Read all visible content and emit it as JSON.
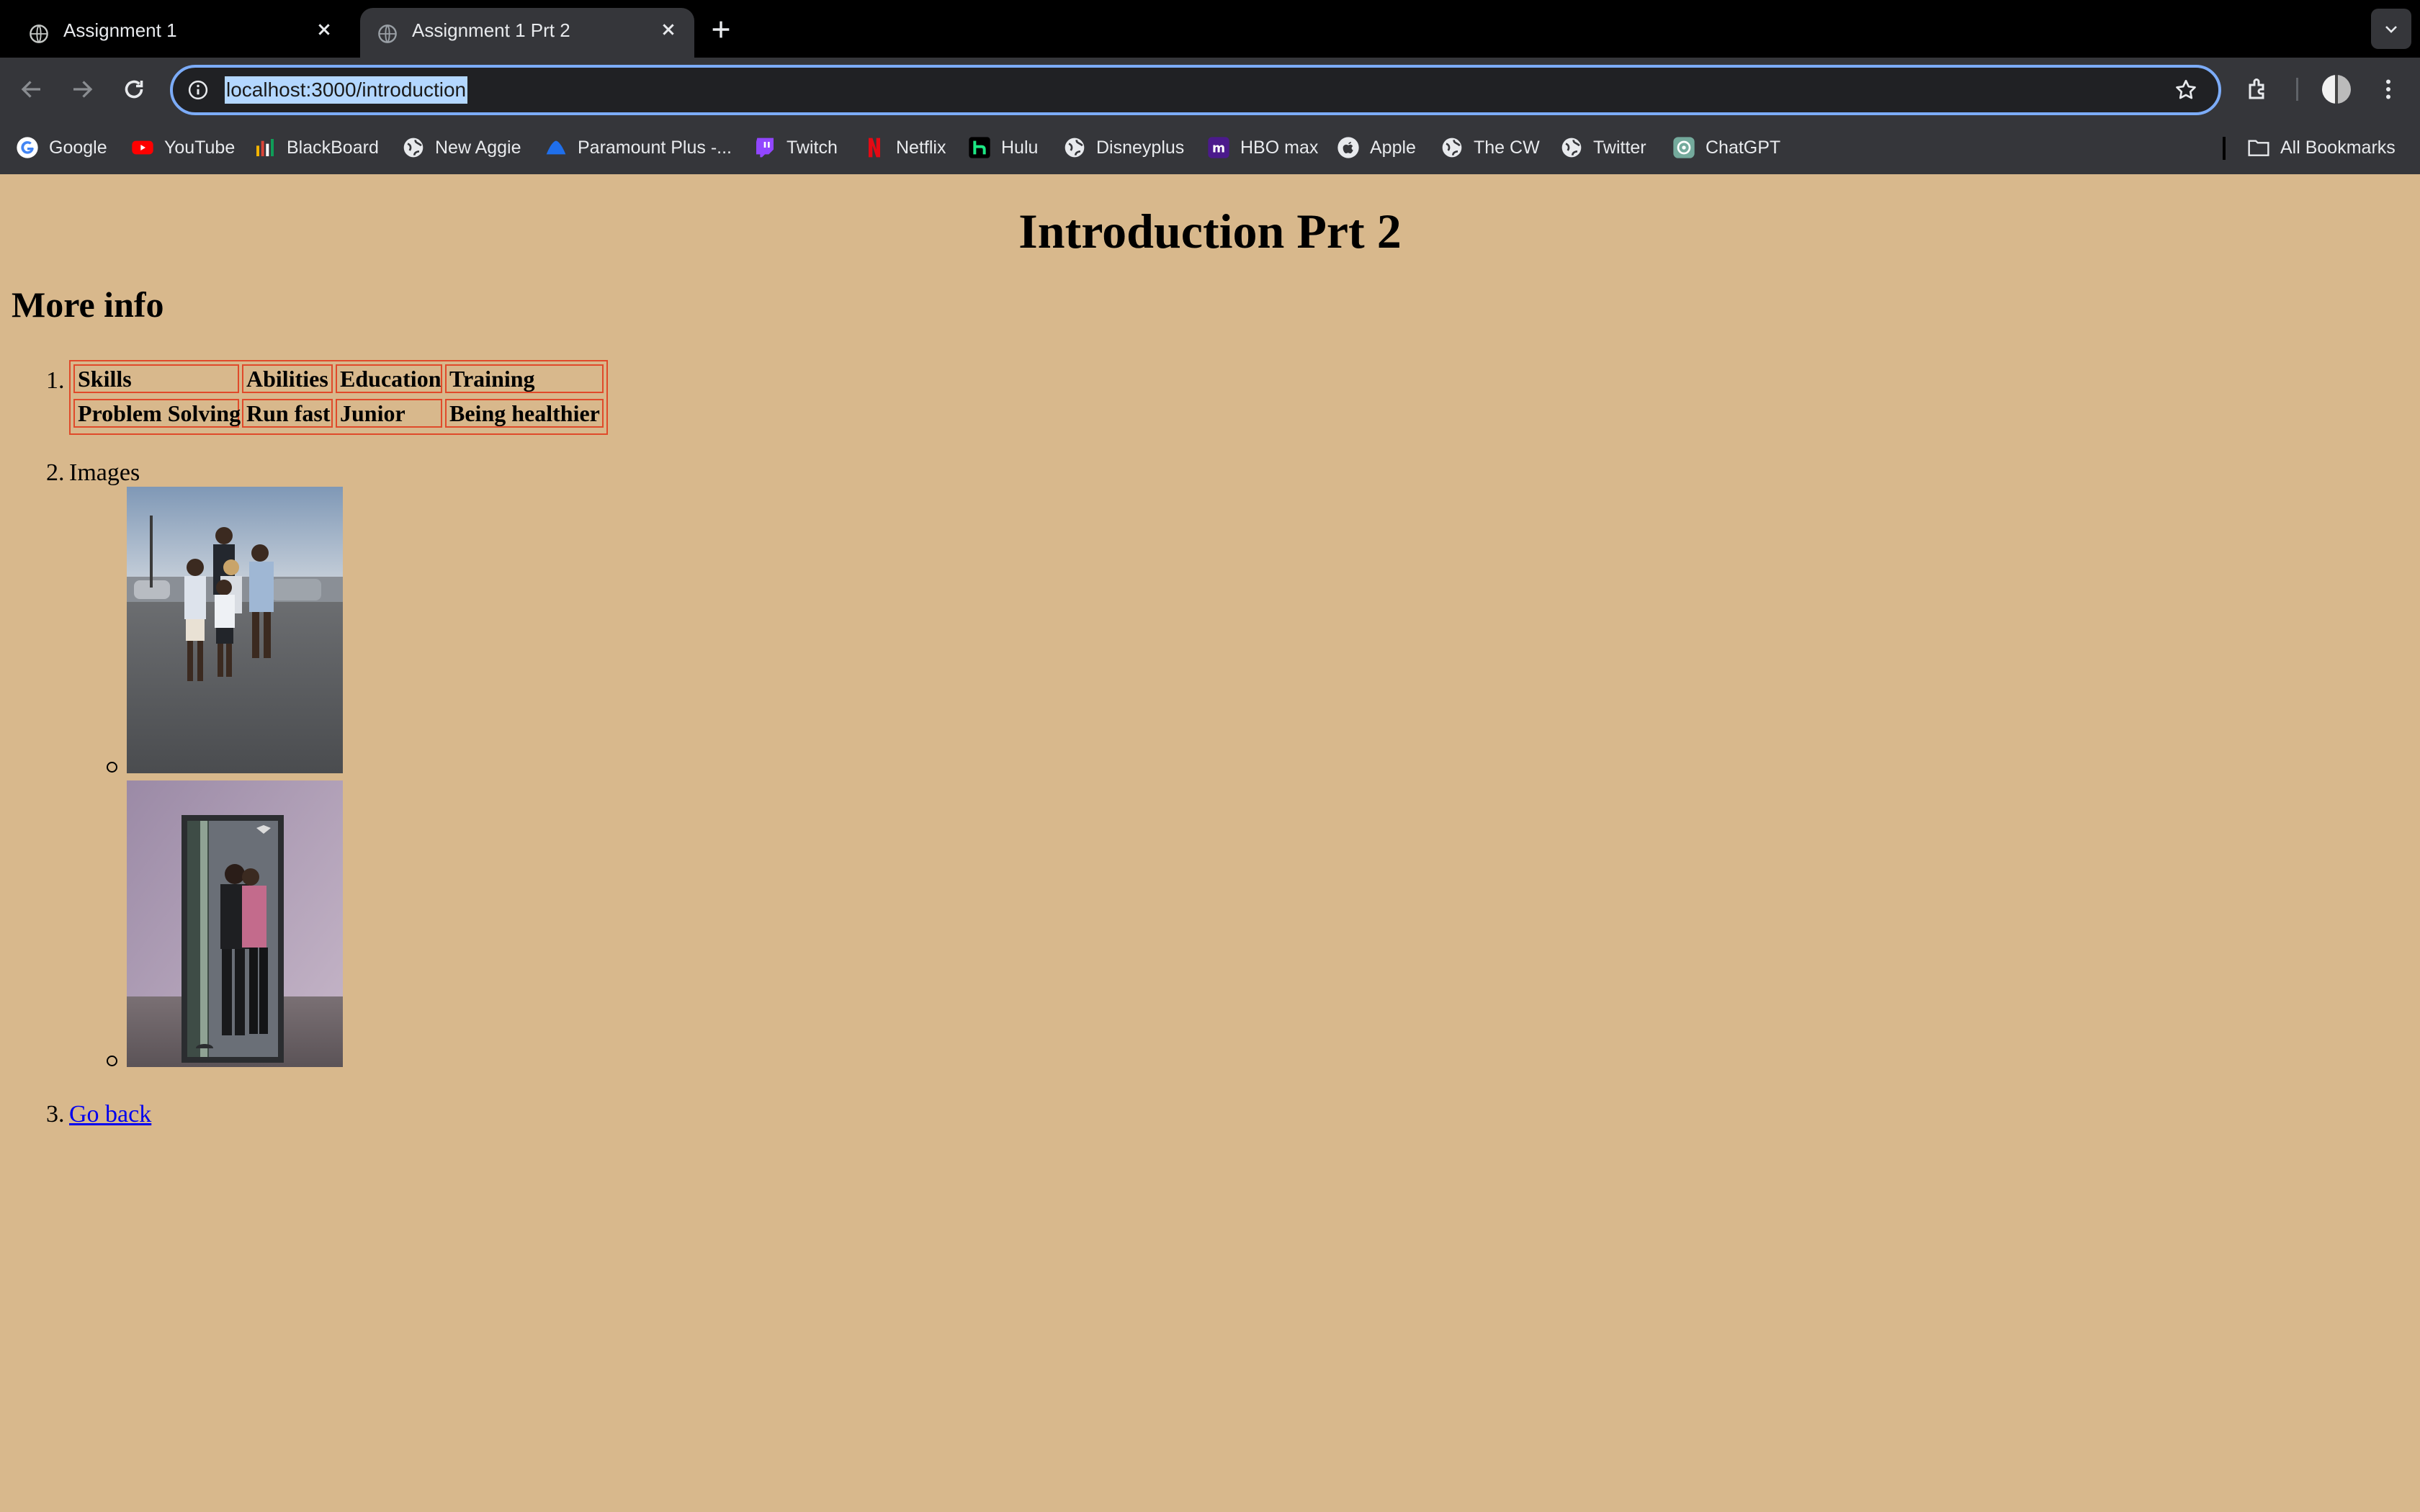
{
  "browser": {
    "tabs": [
      {
        "title": "Assignment 1",
        "active": false
      },
      {
        "title": "Assignment 1 Prt 2",
        "active": true
      }
    ],
    "url": "localhost:3000/introduction",
    "bookmarks": [
      {
        "label": "Google",
        "icon": "google-icon"
      },
      {
        "label": "YouTube",
        "icon": "youtube-icon"
      },
      {
        "label": "BlackBoard",
        "icon": "blackboard-icon"
      },
      {
        "label": "New Aggie",
        "icon": "globe-icon"
      },
      {
        "label": "Paramount Plus -...",
        "icon": "paramount-icon"
      },
      {
        "label": "Twitch",
        "icon": "twitch-icon"
      },
      {
        "label": "Netflix",
        "icon": "netflix-icon"
      },
      {
        "label": "Hulu",
        "icon": "hulu-icon"
      },
      {
        "label": "Disneyplus",
        "icon": "globe-icon"
      },
      {
        "label": "HBO max",
        "icon": "hbo-icon"
      },
      {
        "label": "Apple",
        "icon": "apple-icon"
      },
      {
        "label": "The CW",
        "icon": "globe-icon"
      },
      {
        "label": "Twitter",
        "icon": "globe-icon"
      },
      {
        "label": "ChatGPT",
        "icon": "chatgpt-icon"
      }
    ],
    "all_bookmarks_label": "All Bookmarks"
  },
  "page": {
    "background_color": "#d8b88c",
    "title": "Introduction Prt 2",
    "subtitle": "More info",
    "list_markers": [
      "1.",
      "2.",
      "3."
    ],
    "table": {
      "headers": [
        "Skills",
        "Abilities",
        "Education",
        "Training"
      ],
      "rows": [
        [
          "Problem Solving",
          "Run fast",
          "Junior",
          "Being healthier"
        ]
      ],
      "border_color": "#e04a2a"
    },
    "images_label": "Images",
    "images": [
      {
        "description": "family group photo in a parking lot"
      },
      {
        "description": "mirror selfie of two people"
      }
    ],
    "link_label": "Go back"
  }
}
